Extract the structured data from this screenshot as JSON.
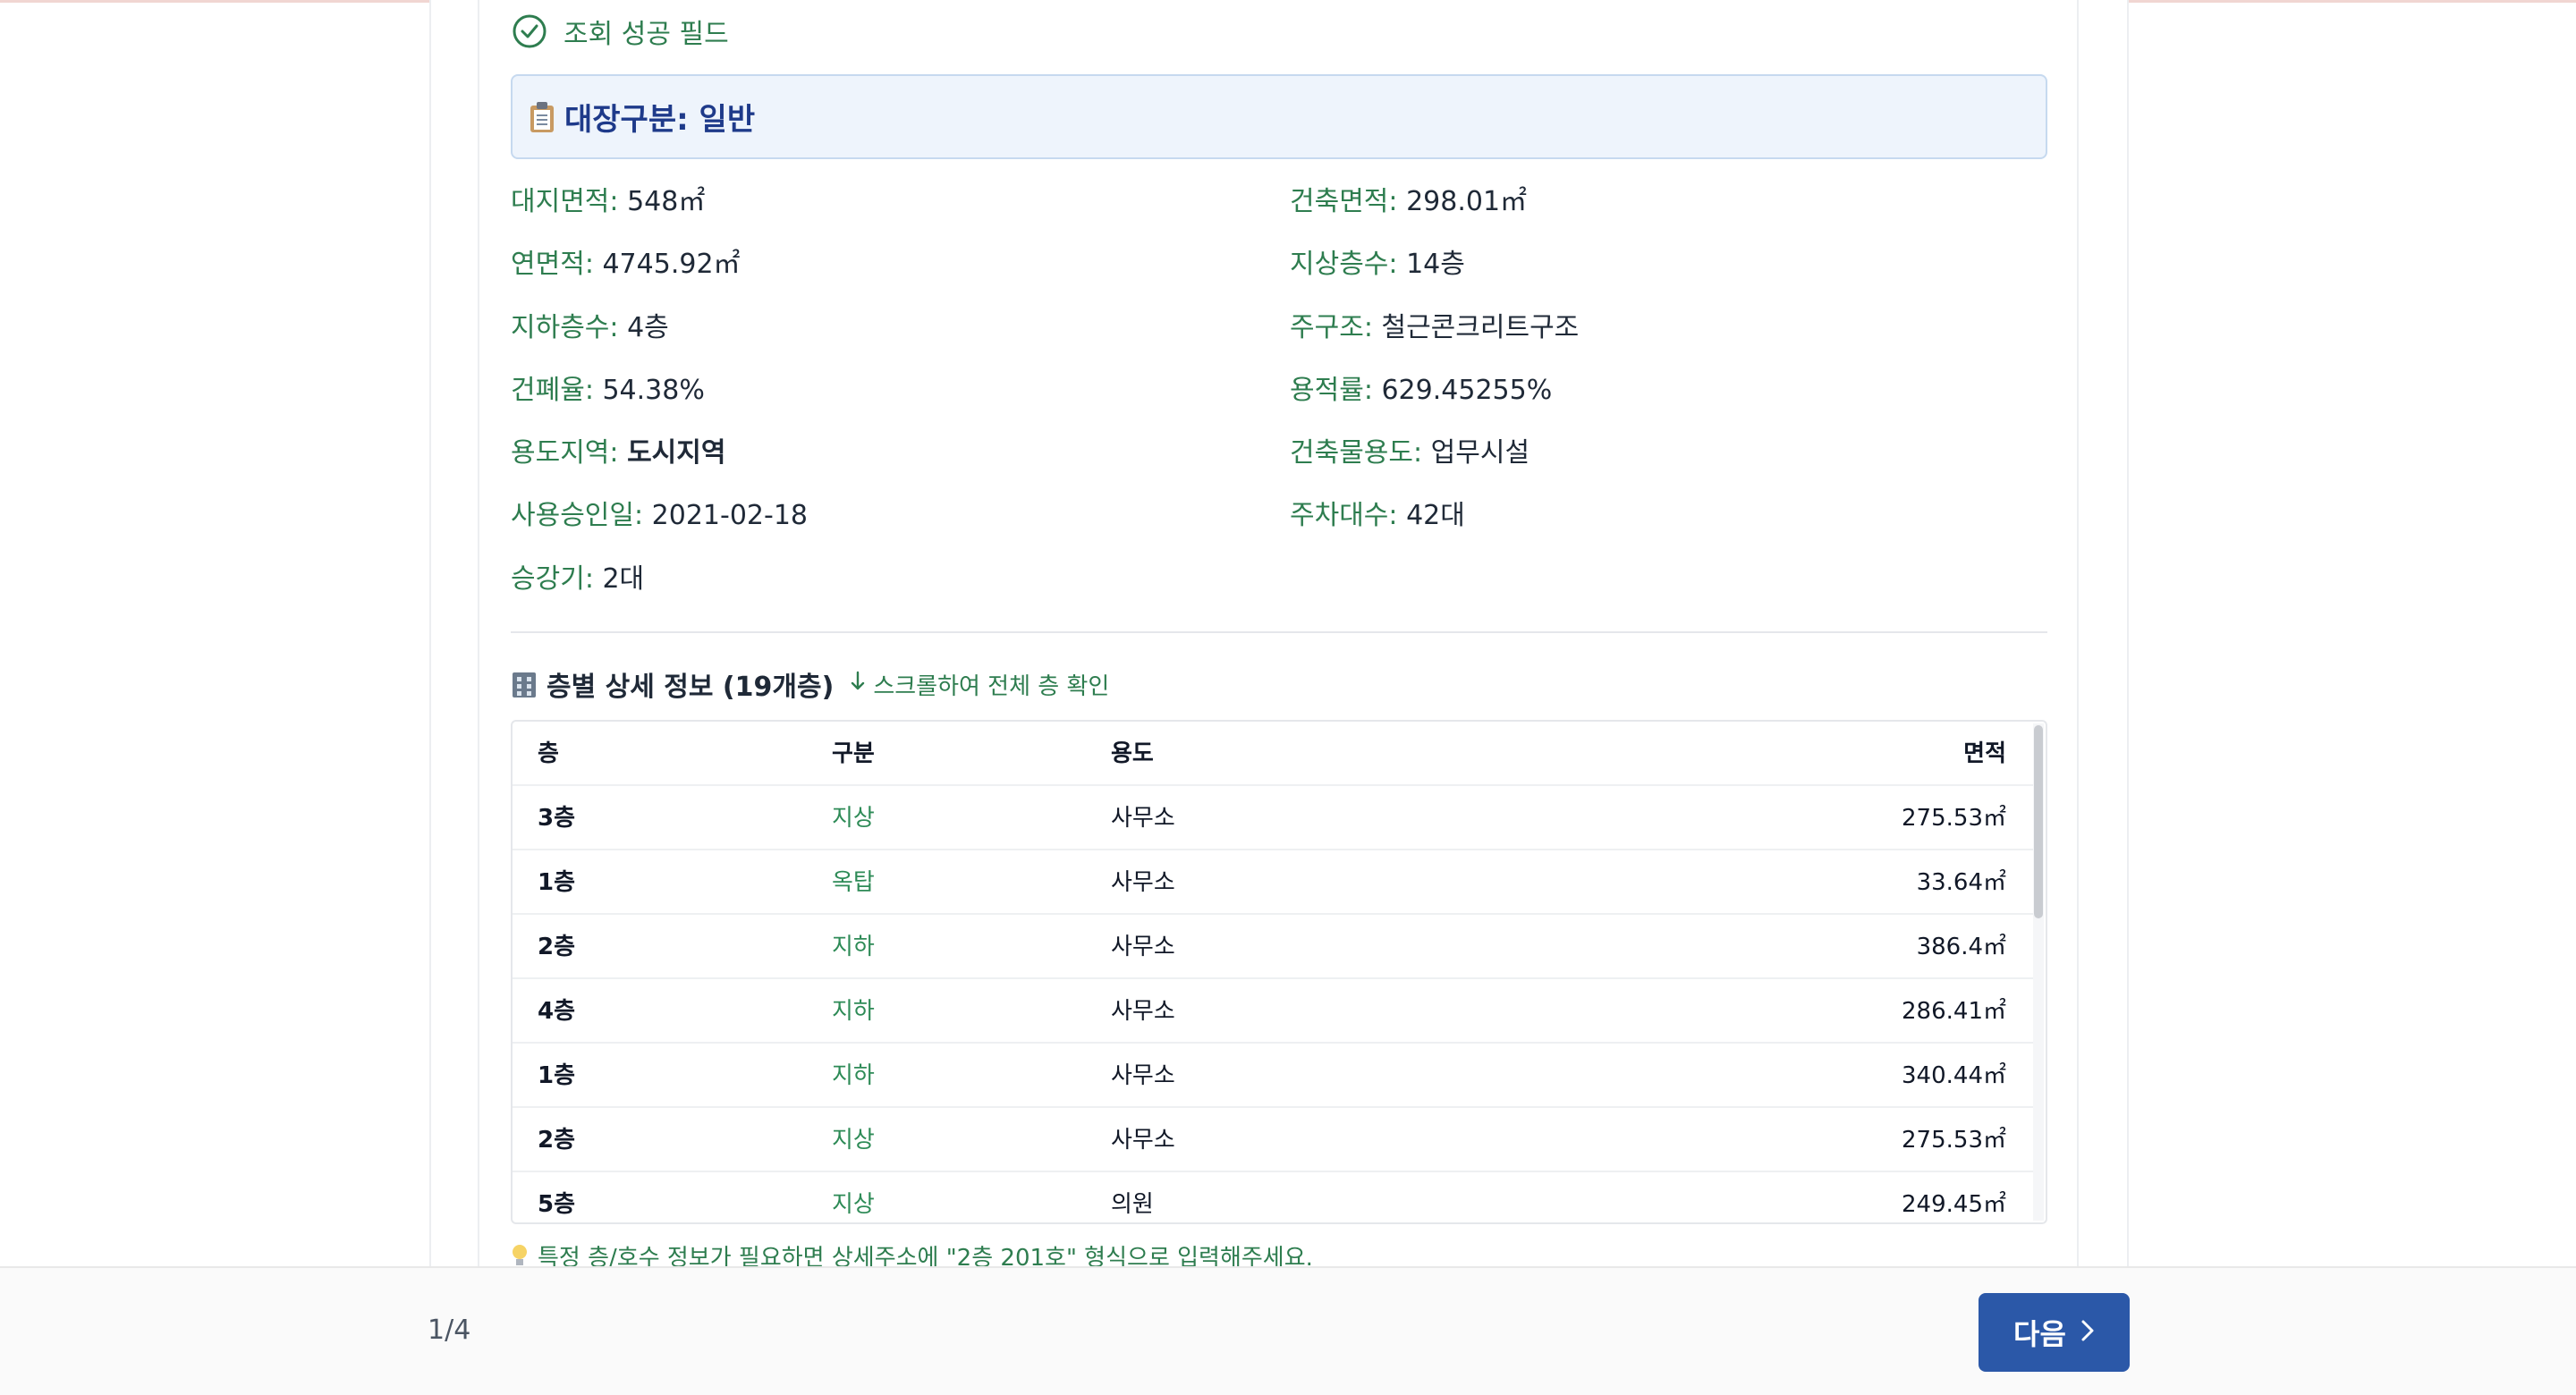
{
  "status": {
    "label": "조회 성공 필드",
    "icon": "check-circle-icon"
  },
  "card": {
    "icon": "clipboard-icon",
    "title": "대장구분: 일반"
  },
  "info": [
    {
      "key": "대지면적",
      "value": "548㎡"
    },
    {
      "key": "건축면적",
      "value": "298.01㎡"
    },
    {
      "key": "연면적",
      "value": "4745.92㎡"
    },
    {
      "key": "지상층수",
      "value": "14층"
    },
    {
      "key": "지하층수",
      "value": "4층"
    },
    {
      "key": "주구조",
      "value": "철근콘크리트구조"
    },
    {
      "key": "건폐율",
      "value": "54.38%"
    },
    {
      "key": "용적률",
      "value": "629.45255%"
    },
    {
      "key": "용도지역",
      "value": "도시지역"
    },
    {
      "key": "건축물용도",
      "value": "업무시설"
    },
    {
      "key": "사용승인일",
      "value": "2021-02-18"
    },
    {
      "key": "주차대수",
      "value": "42대"
    },
    {
      "key": "승강기",
      "value": "2대"
    }
  ],
  "floors": {
    "icon": "office-building-icon",
    "title": "층별 상세 정보 (19개층)",
    "scroll_hint": "스크롤하여 전체 층 확인",
    "scroll_hint_icon": "arrow-down-icon",
    "columns": [
      "층",
      "구분",
      "용도",
      "면적"
    ],
    "rows": [
      {
        "floor": "3층",
        "division": "지상",
        "use": "사무소",
        "area": "275.53㎡"
      },
      {
        "floor": "1층",
        "division": "옥탑",
        "use": "사무소",
        "area": "33.64㎡"
      },
      {
        "floor": "2층",
        "division": "지하",
        "use": "사무소",
        "area": "386.4㎡"
      },
      {
        "floor": "4층",
        "division": "지하",
        "use": "사무소",
        "area": "286.41㎡"
      },
      {
        "floor": "1층",
        "division": "지하",
        "use": "사무소",
        "area": "340.44㎡"
      },
      {
        "floor": "2층",
        "division": "지상",
        "use": "사무소",
        "area": "275.53㎡"
      },
      {
        "floor": "5층",
        "division": "지상",
        "use": "의원",
        "area": "249.45㎡"
      }
    ]
  },
  "tip": {
    "icon": "lightbulb-icon",
    "text": "특정 층/호수 정보가 필요하면 상세주소에 \"2층 201호\" 형식으로 입력해주세요."
  },
  "footer": {
    "page_indicator": "1/4",
    "next_label": "다음",
    "next_icon": "chevron-right-icon"
  }
}
